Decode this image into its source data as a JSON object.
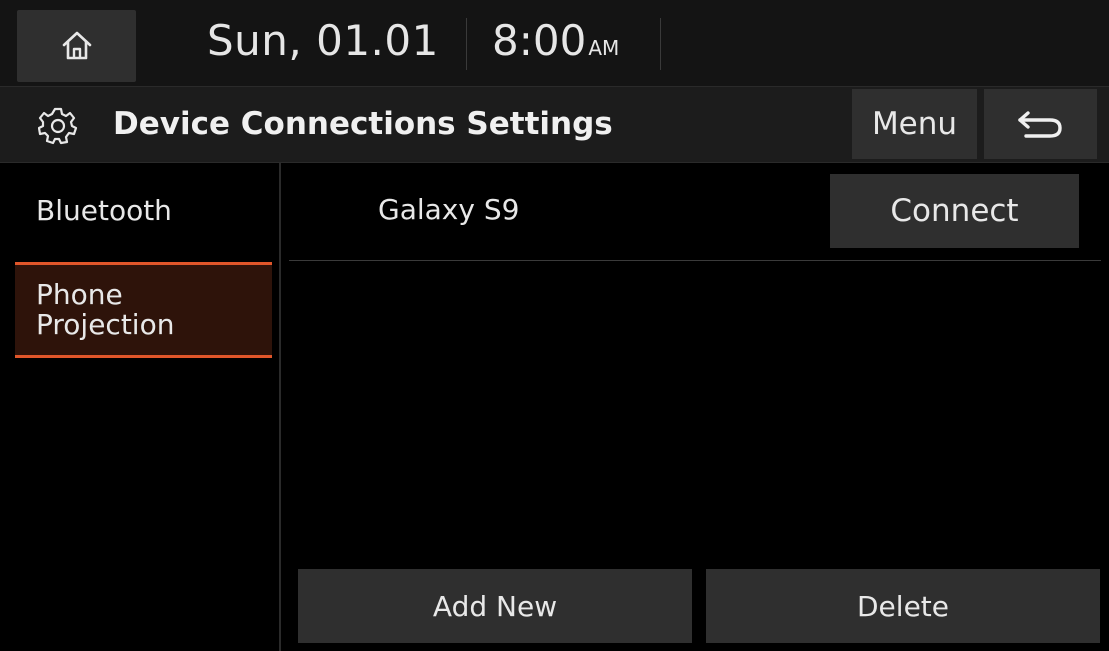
{
  "status_bar": {
    "date": "Sun, 01.01",
    "time": "8:00",
    "ampm": "AM"
  },
  "header": {
    "title": "Device Connections Settings",
    "menu_label": "Menu",
    "icons": [
      "home-icon",
      "gear-icon",
      "back-arrow-icon"
    ]
  },
  "sidebar": {
    "items": [
      {
        "label": "Bluetooth",
        "active": false
      },
      {
        "label": "Phone Projection",
        "active": true
      }
    ]
  },
  "devices": [
    {
      "name": "Galaxy S9",
      "action_label": "Connect"
    }
  ],
  "footer": {
    "add_new_label": "Add New",
    "delete_label": "Delete"
  },
  "colors": {
    "accent": "#e0562a",
    "active_bg": "#2e130a",
    "button_bg": "#2f2f2f"
  }
}
